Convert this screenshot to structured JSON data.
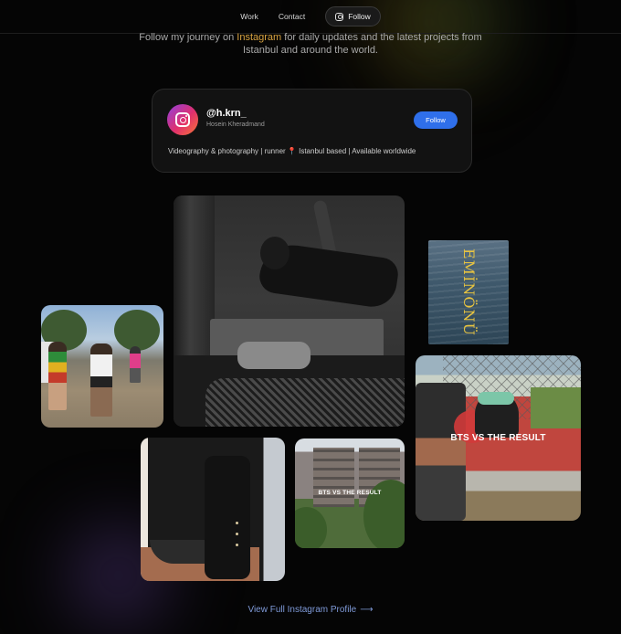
{
  "nav": {
    "items": [
      {
        "label": "Work"
      },
      {
        "label": "Contact"
      }
    ],
    "follow_label": "Follow"
  },
  "intro": {
    "before": "Follow my journey on ",
    "highlight": "Instagram",
    "after": " for daily updates and the latest projects from Istanbul and around the world."
  },
  "profile": {
    "handle": "@h.krn_",
    "name": "Hosein Kheradmand",
    "follow_label": "Follow",
    "bio_before": "Videography & photography | runner ",
    "bio_pin": "📍",
    "bio_after": " Istanbul based | Available worldwide"
  },
  "gallery": {
    "eminonu_text": "EMİNÖNÜ",
    "bts_small": "BTS VS THE RESULT",
    "bts_large": "BTS VS THE RESULT"
  },
  "cta": {
    "label": "View Full Instagram Profile",
    "arrow": "⟶"
  },
  "colors": {
    "background": "#050505",
    "accent_blue": "#2f6fea",
    "highlight_gold": "#d9a441",
    "cta_blue": "#7f9ad8"
  },
  "icons": [
    "instagram-icon",
    "arrow-right-icon",
    "location-pin-icon"
  ]
}
